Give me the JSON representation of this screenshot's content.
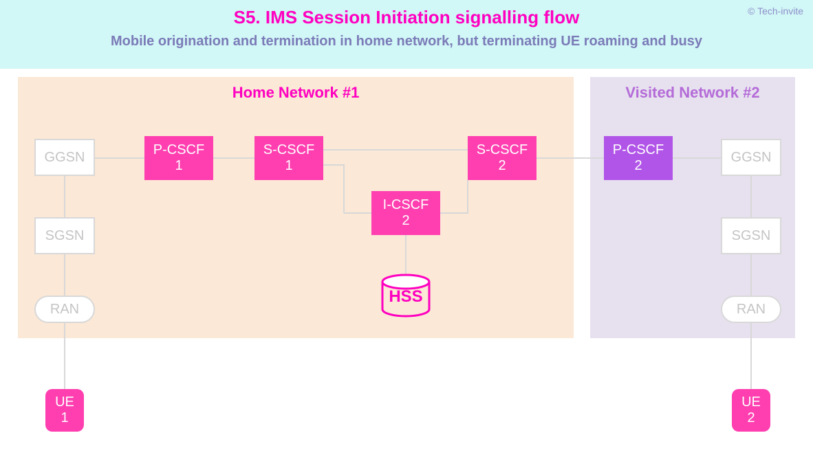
{
  "header": {
    "title": "S5. IMS Session Initiation signalling flow",
    "subtitle": "Mobile origination and termination in home network, but terminating UE roaming and busy",
    "copyright": "© Tech-invite"
  },
  "regions": {
    "home_label": "Home Network #1",
    "visited_label": "Visited Network #2"
  },
  "nodes": {
    "ggsn1": {
      "l1": "GGSN"
    },
    "sgsn1": {
      "l1": "SGSN"
    },
    "ran1": {
      "l1": "RAN"
    },
    "ue1": {
      "l1": "UE",
      "l2": "1"
    },
    "pcscf1": {
      "l1": "P-CSCF",
      "l2": "1"
    },
    "scscf1": {
      "l1": "S-CSCF",
      "l2": "1"
    },
    "icscf2": {
      "l1": "I-CSCF",
      "l2": "2"
    },
    "scscf2": {
      "l1": "S-CSCF",
      "l2": "2"
    },
    "hss": {
      "l1": "HSS"
    },
    "pcscf2": {
      "l1": "P-CSCF",
      "l2": "2"
    },
    "ggsn2": {
      "l1": "GGSN"
    },
    "sgsn2": {
      "l1": "SGSN"
    },
    "ran2": {
      "l1": "RAN"
    },
    "ue2": {
      "l1": "UE",
      "l2": "2"
    }
  }
}
